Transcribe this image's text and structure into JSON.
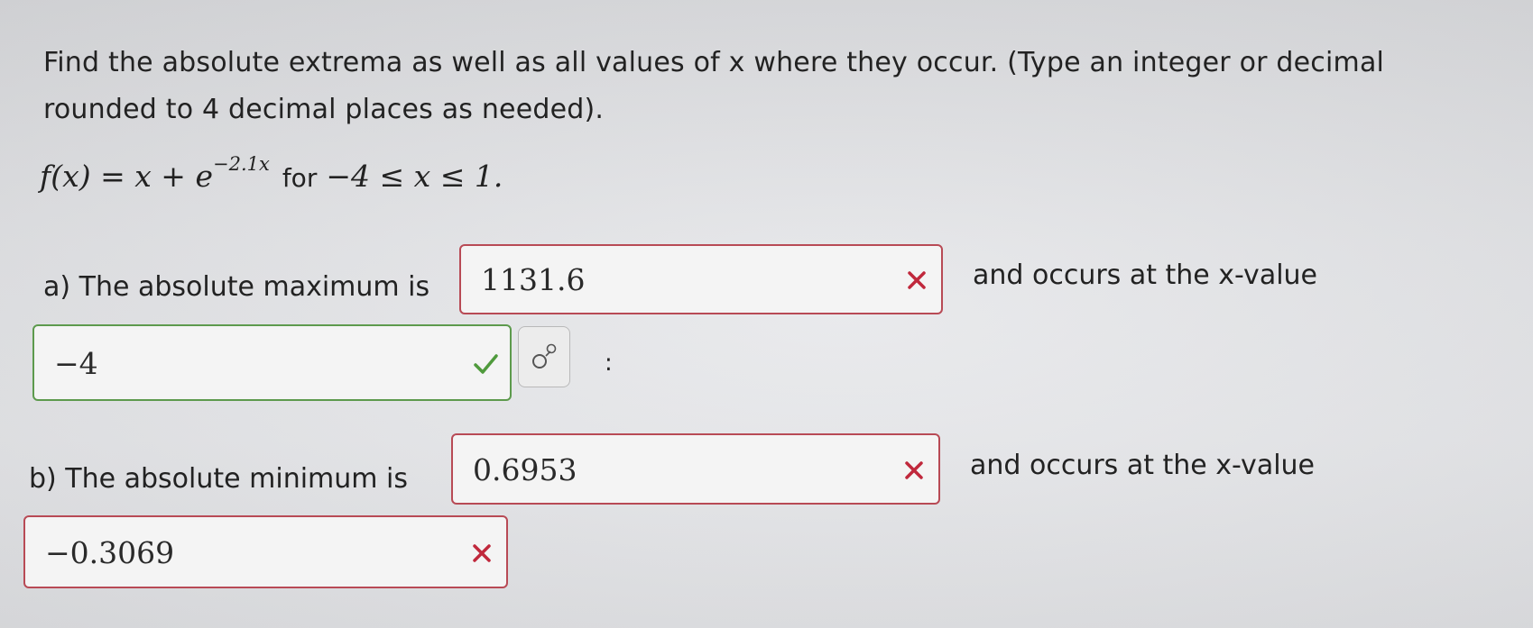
{
  "instructions": {
    "line1": "Find the absolute extrema as well as all values of x where they occur. (Type an integer or decimal",
    "line2": "rounded to 4 decimal places as needed)."
  },
  "formula": {
    "lhs": "f(x) = x + e",
    "exponent": "−2.1x",
    "for_word": "for",
    "domain": "−4 ≤ x ≤ 1."
  },
  "part_a": {
    "prompt": "a) The absolute maximum is",
    "max_answer": "1131.6",
    "max_status": "incorrect",
    "connector": "and occurs at the x-value",
    "x_answer": "−4",
    "x_status": "correct",
    "trailing": ":"
  },
  "part_b": {
    "prompt": "b) The absolute minimum is",
    "min_answer": "0.6953",
    "min_status": "incorrect",
    "connector": "and occurs at the x-value",
    "x_answer": "−0.3069",
    "x_status": "incorrect"
  },
  "icons": {
    "incorrect": "x-mark-icon",
    "correct": "check-mark-icon",
    "equation_editor": "equation-editor-icon"
  },
  "colors": {
    "incorrect": "#c0283c",
    "correct": "#4f9a3c",
    "incorrect_border": "#b84a55",
    "correct_border": "#5d9a4d"
  }
}
